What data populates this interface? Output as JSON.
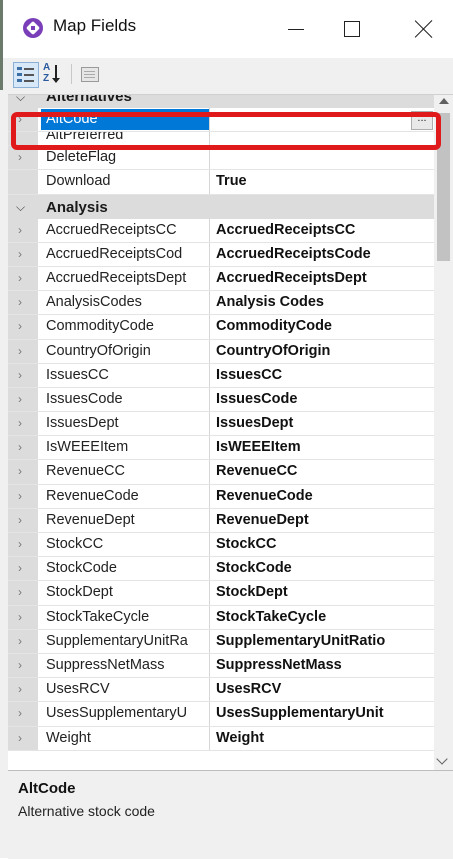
{
  "window": {
    "title": "Map Fields",
    "icon": "app-logo-icon",
    "controls": {
      "minimize": "minimize-icon",
      "maximize": "maximize-icon",
      "close": "close-icon"
    }
  },
  "toolbar": {
    "categorized_icon": "categorized-view-icon",
    "alphabetical_icon": "sort-az-icon",
    "alphabetical_a": "A",
    "alphabetical_z": "Z",
    "property_pages_icon": "property-pages-icon"
  },
  "grid": {
    "categories": [
      {
        "label": "Alternatives",
        "properties": [
          {
            "name": "AltCode",
            "value": "",
            "selected": true,
            "button": "..."
          },
          {
            "name": "AltPreferred",
            "value": ""
          },
          {
            "name": "DeleteFlag",
            "value": ""
          },
          {
            "name": "Download",
            "value": "True"
          }
        ]
      },
      {
        "label": "Analysis",
        "properties": [
          {
            "name": "AccruedReceiptsCC",
            "value": "AccruedReceiptsCC"
          },
          {
            "name": "AccruedReceiptsCod",
            "value": "AccruedReceiptsCode"
          },
          {
            "name": "AccruedReceiptsDept",
            "value": "AccruedReceiptsDept"
          },
          {
            "name": "AnalysisCodes",
            "value": "Analysis Codes"
          },
          {
            "name": "CommodityCode",
            "value": "CommodityCode"
          },
          {
            "name": "CountryOfOrigin",
            "value": "CountryOfOrigin"
          },
          {
            "name": "IssuesCC",
            "value": "IssuesCC"
          },
          {
            "name": "IssuesCode",
            "value": "IssuesCode"
          },
          {
            "name": "IssuesDept",
            "value": "IssuesDept"
          },
          {
            "name": "IsWEEEItem",
            "value": "IsWEEEItem"
          },
          {
            "name": "RevenueCC",
            "value": "RevenueCC"
          },
          {
            "name": "RevenueCode",
            "value": "RevenueCode"
          },
          {
            "name": "RevenueDept",
            "value": "RevenueDept"
          },
          {
            "name": "StockCC",
            "value": "StockCC"
          },
          {
            "name": "StockCode",
            "value": "StockCode"
          },
          {
            "name": "StockDept",
            "value": "StockDept"
          },
          {
            "name": "StockTakeCycle",
            "value": "StockTakeCycle"
          },
          {
            "name": "SupplementaryUnitRa",
            "value": "SupplementaryUnitRatio"
          },
          {
            "name": "SuppressNetMass",
            "value": "SuppressNetMass"
          },
          {
            "name": "UsesRCV",
            "value": "UsesRCV"
          },
          {
            "name": "UsesSupplementaryU",
            "value": "UsesSupplementaryUnit"
          },
          {
            "name": "Weight",
            "value": "Weight"
          }
        ]
      }
    ],
    "collapse_glyph": "⌵",
    "expand_glyph": "›"
  },
  "help": {
    "title": "AltCode",
    "description": "Alternative stock code"
  },
  "colors": {
    "selection": "#0078d7",
    "highlight": "#e01a1a",
    "category_bg": "#dcdcdc"
  }
}
